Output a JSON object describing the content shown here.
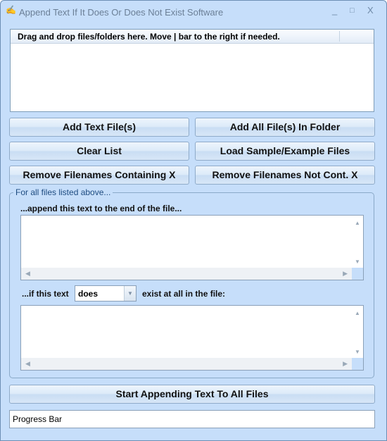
{
  "window": {
    "title": "Append Text If It Does Or Does Not Exist Software",
    "minimize": "_",
    "maximize": "□",
    "close": "X"
  },
  "file_list": {
    "header": "Drag and drop files/folders here. Move | bar to the right if needed."
  },
  "buttons": {
    "add_text_files": "Add Text File(s)",
    "add_all_in_folder": "Add All File(s) In Folder",
    "clear_list": "Clear List",
    "load_sample": "Load Sample/Example Files",
    "remove_containing": "Remove Filenames Containing X",
    "remove_not_containing": "Remove Filenames Not Cont. X",
    "start": "Start Appending Text To All Files"
  },
  "options": {
    "group_label": "For all files listed above...",
    "append_label": "...append this text to the end of the file...",
    "append_text": "",
    "condition_prefix": "...if this text",
    "condition_value": "does",
    "condition_suffix": "exist at all in the file:",
    "search_text": ""
  },
  "progress": {
    "label": "Progress Bar"
  }
}
